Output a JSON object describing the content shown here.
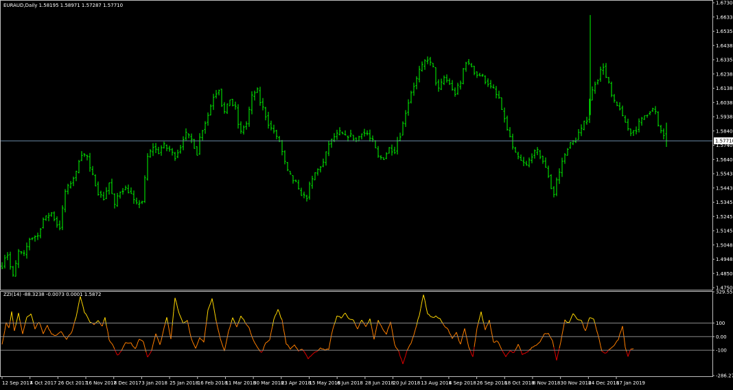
{
  "main_panel": {
    "header": "EURAUD,Daily  1.58195 1.58971 1.57287 1.57710",
    "current_price": "1.57710",
    "y_ticks": [
      "1.67305",
      "1.66330",
      "1.65355",
      "1.64380",
      "1.63355",
      "1.62380",
      "1.61380",
      "1.60380",
      "1.59380",
      "1.58405",
      "1.57405",
      "1.56405",
      "1.55430",
      "1.54430",
      "1.53455",
      "1.52455",
      "1.51455",
      "1.50480",
      "1.49480",
      "1.48505",
      "1.47505"
    ]
  },
  "indicator_panel": {
    "header": "ZZI(14) -88.3238 -0.0073 0.0001 1.5872",
    "y_ticks": [
      "329.5595",
      "100",
      "0.00",
      "-100",
      "-286.27"
    ]
  },
  "x_ticks": [
    "12 Sep 2017",
    "4 Oct 2017",
    "26 Oct 2017",
    "16 Nov 2017",
    "8 Dec 2017",
    "3 Jan 2018",
    "25 Jan 2018",
    "16 Feb 2018",
    "11 Mar 2018",
    "30 Mar 2018",
    "23 Apr 2018",
    "15 May 2018",
    "6 Jun 2018",
    "28 Jun 2018",
    "20 Jul 2018",
    "13 Aug 2018",
    "4 Sep 2018",
    "26 Sep 2018",
    "18 Oct 2018",
    "8 Nov 2018",
    "30 Nov 2018",
    "24 Dec 2018",
    "17 Jan 2019"
  ],
  "colors": {
    "background": "#000000",
    "bar": "#00ff00",
    "axis": "#bfbfbf",
    "label": "#ffffff",
    "price_line": "#6c8da8",
    "price_box": "#ffffff",
    "level_line": "#8a8a8a",
    "cci_high": "#ffd700",
    "cci_mid": "#ff7f00",
    "cci_low": "#e00000"
  },
  "chart_data": [
    {
      "type": "ohlc",
      "symbol": "EURAUD",
      "timeframe": "Daily",
      "last": {
        "open": 1.58195,
        "high": 1.58971,
        "low": 1.57287,
        "close": 1.5771
      },
      "ylim": [
        1.47505,
        1.67305
      ],
      "anchors": [
        [
          0,
          1.49
        ],
        [
          5,
          1.498
        ],
        [
          12,
          1.483
        ],
        [
          20,
          1.5
        ],
        [
          28,
          1.498
        ],
        [
          36,
          1.509
        ],
        [
          45,
          1.511
        ],
        [
          54,
          1.524
        ],
        [
          62,
          1.527
        ],
        [
          72,
          1.517
        ],
        [
          80,
          1.542
        ],
        [
          88,
          1.548
        ],
        [
          96,
          1.555
        ],
        [
          102,
          1.568
        ],
        [
          110,
          1.566
        ],
        [
          116,
          1.553
        ],
        [
          124,
          1.541
        ],
        [
          132,
          1.537
        ],
        [
          140,
          1.548
        ],
        [
          148,
          1.532
        ],
        [
          154,
          1.542
        ],
        [
          162,
          1.544
        ],
        [
          170,
          1.54
        ],
        [
          176,
          1.533
        ],
        [
          182,
          1.535
        ],
        [
          190,
          1.566
        ],
        [
          198,
          1.573
        ],
        [
          206,
          1.569
        ],
        [
          212,
          1.574
        ],
        [
          218,
          1.571
        ],
        [
          226,
          1.566
        ],
        [
          234,
          1.573
        ],
        [
          240,
          1.582
        ],
        [
          248,
          1.578
        ],
        [
          256,
          1.568
        ],
        [
          262,
          1.585
        ],
        [
          270,
          1.595
        ],
        [
          278,
          1.608
        ],
        [
          286,
          1.613
        ],
        [
          292,
          1.597
        ],
        [
          300,
          1.606
        ],
        [
          306,
          1.6
        ],
        [
          312,
          1.583
        ],
        [
          318,
          1.589
        ],
        [
          326,
          1.608
        ],
        [
          332,
          1.612
        ],
        [
          338,
          1.6
        ],
        [
          346,
          1.589
        ],
        [
          352,
          1.584
        ],
        [
          358,
          1.577
        ],
        [
          366,
          1.562
        ],
        [
          372,
          1.553
        ],
        [
          378,
          1.548
        ],
        [
          384,
          1.54
        ],
        [
          390,
          1.538
        ],
        [
          396,
          1.55
        ],
        [
          402,
          1.557
        ],
        [
          410,
          1.562
        ],
        [
          418,
          1.575
        ],
        [
          426,
          1.58
        ],
        [
          434,
          1.583
        ],
        [
          442,
          1.58
        ],
        [
          450,
          1.581
        ],
        [
          458,
          1.577
        ],
        [
          466,
          1.583
        ],
        [
          472,
          1.582
        ],
        [
          478,
          1.577
        ],
        [
          486,
          1.566
        ],
        [
          492,
          1.565
        ],
        [
          500,
          1.572
        ],
        [
          506,
          1.57
        ],
        [
          512,
          1.581
        ],
        [
          520,
          1.597
        ],
        [
          528,
          1.611
        ],
        [
          536,
          1.62
        ],
        [
          542,
          1.629
        ],
        [
          548,
          1.634
        ],
        [
          556,
          1.628
        ],
        [
          562,
          1.613
        ],
        [
          570,
          1.621
        ],
        [
          578,
          1.617
        ],
        [
          584,
          1.61
        ],
        [
          590,
          1.617
        ],
        [
          596,
          1.632
        ],
        [
          602,
          1.629
        ],
        [
          608,
          1.623
        ],
        [
          616,
          1.622
        ],
        [
          622,
          1.617
        ],
        [
          628,
          1.613
        ],
        [
          634,
          1.607
        ],
        [
          640,
          1.593
        ],
        [
          646,
          1.58
        ],
        [
          652,
          1.568
        ],
        [
          660,
          1.563
        ],
        [
          668,
          1.56
        ],
        [
          676,
          1.567
        ],
        [
          682,
          1.57
        ],
        [
          690,
          1.563
        ],
        [
          698,
          1.553
        ],
        [
          704,
          1.54
        ],
        [
          710,
          1.555
        ],
        [
          716,
          1.567
        ],
        [
          722,
          1.575
        ],
        [
          730,
          1.578
        ],
        [
          736,
          1.585
        ],
        [
          742,
          1.592
        ],
        [
          748,
          1.612
        ],
        [
          754,
          1.62
        ],
        [
          760,
          1.629
        ],
        [
          766,
          1.617
        ],
        [
          772,
          1.604
        ],
        [
          778,
          1.6
        ],
        [
          784,
          1.59
        ],
        [
          790,
          1.583
        ],
        [
          796,
          1.585
        ],
        [
          802,
          1.592
        ],
        [
          808,
          1.596
        ],
        [
          814,
          1.599
        ],
        [
          818,
          1.597
        ],
        [
          822,
          1.587
        ],
        [
          826,
          1.584
        ],
        [
          829,
          1.581
        ],
        [
          832,
          1.5771
        ]
      ]
    },
    {
      "type": "line",
      "name": "ZZI(14)",
      "last_value": -88.3238,
      "ylim": [
        -286.27,
        329.5595
      ],
      "levels": [
        100,
        0,
        -100
      ],
      "anchors": [
        [
          0,
          -60
        ],
        [
          6,
          100
        ],
        [
          10,
          60
        ],
        [
          14,
          180
        ],
        [
          18,
          40
        ],
        [
          24,
          170
        ],
        [
          30,
          20
        ],
        [
          36,
          140
        ],
        [
          42,
          170
        ],
        [
          48,
          60
        ],
        [
          54,
          110
        ],
        [
          60,
          20
        ],
        [
          66,
          80
        ],
        [
          72,
          20
        ],
        [
          78,
          10
        ],
        [
          86,
          40
        ],
        [
          94,
          -20
        ],
        [
          102,
          40
        ],
        [
          108,
          150
        ],
        [
          114,
          300
        ],
        [
          120,
          180
        ],
        [
          128,
          110
        ],
        [
          134,
          90
        ],
        [
          140,
          120
        ],
        [
          146,
          80
        ],
        [
          150,
          140
        ],
        [
          156,
          -20
        ],
        [
          162,
          -70
        ],
        [
          168,
          -140
        ],
        [
          174,
          -100
        ],
        [
          180,
          -40
        ],
        [
          188,
          -50
        ],
        [
          194,
          -90
        ],
        [
          200,
          -20
        ],
        [
          206,
          -40
        ],
        [
          212,
          -150
        ],
        [
          218,
          -100
        ],
        [
          224,
          20
        ],
        [
          230,
          -60
        ],
        [
          236,
          60
        ],
        [
          240,
          140
        ],
        [
          246,
          -20
        ],
        [
          252,
          290
        ],
        [
          258,
          170
        ],
        [
          264,
          100
        ],
        [
          270,
          120
        ],
        [
          276,
          -20
        ],
        [
          282,
          -90
        ],
        [
          288,
          -10
        ],
        [
          294,
          -40
        ],
        [
          300,
          200
        ],
        [
          306,
          280
        ],
        [
          312,
          120
        ],
        [
          318,
          -20
        ],
        [
          324,
          -110
        ],
        [
          330,
          40
        ],
        [
          336,
          140
        ],
        [
          342,
          70
        ],
        [
          348,
          150
        ],
        [
          354,
          110
        ],
        [
          360,
          60
        ],
        [
          366,
          -20
        ],
        [
          372,
          -80
        ],
        [
          378,
          -120
        ],
        [
          384,
          -50
        ],
        [
          390,
          -20
        ],
        [
          396,
          130
        ],
        [
          402,
          200
        ],
        [
          408,
          120
        ],
        [
          414,
          -50
        ],
        [
          420,
          -90
        ],
        [
          426,
          -60
        ],
        [
          432,
          -110
        ],
        [
          438,
          -90
        ],
        [
          446,
          -160
        ],
        [
          452,
          -130
        ],
        [
          458,
          -110
        ],
        [
          464,
          -80
        ],
        [
          470,
          -100
        ],
        [
          476,
          -90
        ],
        [
          482,
          60
        ],
        [
          488,
          150
        ],
        [
          494,
          140
        ],
        [
          500,
          170
        ],
        [
          506,
          130
        ],
        [
          512,
          120
        ],
        [
          518,
          60
        ],
        [
          524,
          120
        ],
        [
          530,
          70
        ],
        [
          536,
          130
        ],
        [
          542,
          -20
        ],
        [
          548,
          120
        ],
        [
          554,
          60
        ],
        [
          560,
          20
        ],
        [
          566,
          110
        ],
        [
          572,
          -60
        ],
        [
          578,
          -110
        ],
        [
          584,
          -200
        ],
        [
          590,
          -100
        ],
        [
          596,
          -50
        ],
        [
          602,
          50
        ],
        [
          608,
          160
        ],
        [
          614,
          310
        ],
        [
          620,
          170
        ],
        [
          626,
          140
        ],
        [
          632,
          150
        ],
        [
          638,
          130
        ],
        [
          644,
          80
        ],
        [
          650,
          50
        ],
        [
          656,
          -10
        ],
        [
          662,
          30
        ],
        [
          668,
          -60
        ],
        [
          674,
          60
        ],
        [
          680,
          -80
        ],
        [
          686,
          -150
        ],
        [
          692,
          60
        ],
        [
          698,
          180
        ],
        [
          704,
          50
        ],
        [
          710,
          120
        ],
        [
          716,
          -40
        ],
        [
          722,
          -30
        ],
        [
          728,
          -90
        ],
        [
          734,
          -150
        ],
        [
          740,
          -100
        ],
        [
          746,
          -120
        ],
        [
          752,
          -60
        ],
        [
          758,
          -130
        ],
        [
          764,
          -120
        ],
        [
          770,
          -90
        ],
        [
          778,
          -60
        ],
        [
          784,
          -40
        ],
        [
          790,
          20
        ],
        [
          796,
          20
        ],
        [
          802,
          -30
        ],
        [
          808,
          -170
        ],
        [
          814,
          -40
        ],
        [
          820,
          120
        ],
        [
          826,
          100
        ],
        [
          832,
          170
        ],
        [
          838,
          130
        ],
        [
          844,
          120
        ],
        [
          850,
          40
        ],
        [
          856,
          140
        ],
        [
          862,
          130
        ],
        [
          868,
          20
        ],
        [
          874,
          -110
        ],
        [
          880,
          -120
        ],
        [
          886,
          -90
        ],
        [
          892,
          -60
        ],
        [
          898,
          -20
        ],
        [
          904,
          80
        ],
        [
          908,
          -80
        ],
        [
          912,
          -150
        ],
        [
          916,
          -90
        ],
        [
          920,
          -88
        ]
      ]
    }
  ]
}
